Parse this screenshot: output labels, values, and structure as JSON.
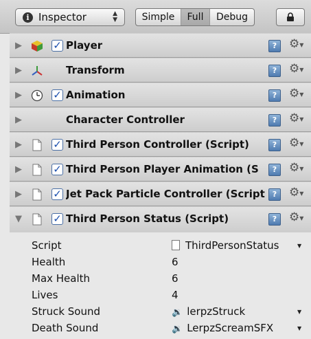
{
  "toolbar": {
    "inspector_label": "Inspector",
    "modes": [
      "Simple",
      "Full",
      "Debug"
    ],
    "active_mode": "Full"
  },
  "components": [
    {
      "title": "Player",
      "icon": "cube-icon",
      "checkbox": true
    },
    {
      "title": "Transform",
      "icon": "transform-axes-icon",
      "checkbox": false
    },
    {
      "title": "Animation",
      "icon": "clock-icon",
      "checkbox": true
    },
    {
      "title": "Character Controller",
      "icon": "none",
      "checkbox": false
    },
    {
      "title": "Third Person Controller (Script)",
      "icon": "script-file-icon",
      "checkbox": true
    },
    {
      "title": "Third Person Player Animation (S",
      "icon": "script-file-icon",
      "checkbox": true
    },
    {
      "title": "Jet Pack Particle Controller (Script",
      "icon": "script-file-icon",
      "checkbox": true
    },
    {
      "title": "Third Person Status (Script)",
      "icon": "script-file-icon",
      "checkbox": true,
      "expanded": true
    }
  ],
  "properties": [
    {
      "label": "Script",
      "value": "ThirdPersonStatus"
    },
    {
      "label": "Health",
      "value": "6"
    },
    {
      "label": "Max Health",
      "value": "6"
    },
    {
      "label": "Lives",
      "value": "4"
    },
    {
      "label": "Struck Sound",
      "value": "lerpzStruck"
    },
    {
      "label": "Death Sound",
      "value": "LerpzScreamSFX"
    }
  ],
  "colors": {
    "checkbox": "#1b4fae",
    "help_icon": "#4f7bb0",
    "panel_bg": "#e8e8e8"
  }
}
